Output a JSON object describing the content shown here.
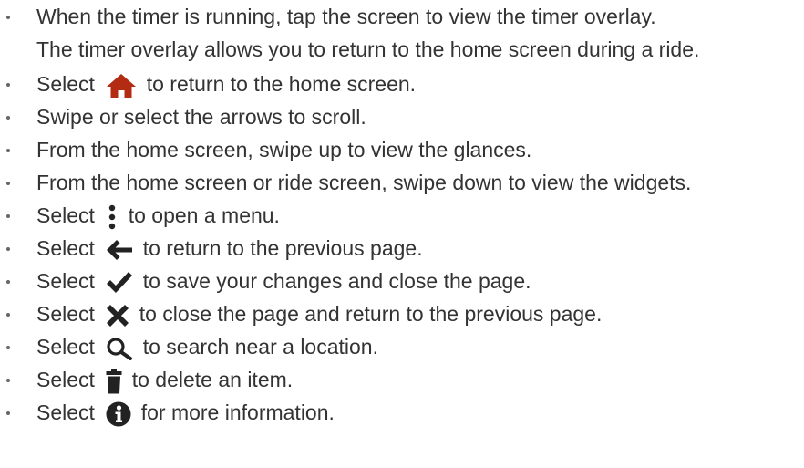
{
  "items": [
    {
      "line1": "When the timer is running, tap the screen to view the timer overlay.",
      "line2": "The timer overlay allows you to return to the home screen during a ride."
    },
    {
      "before": "Select",
      "icon": "home-icon",
      "after": "to return to the home screen."
    },
    {
      "text": "Swipe or select the arrows to scroll."
    },
    {
      "text": "From the home screen, swipe up to view the glances."
    },
    {
      "text": "From the home screen or ride screen, swipe down to view the widgets."
    },
    {
      "before": "Select",
      "icon": "menu-dots-icon",
      "after": "to open a menu."
    },
    {
      "before": "Select",
      "icon": "back-arrow-icon",
      "after": "to return to the previous page."
    },
    {
      "before": "Select",
      "icon": "checkmark-icon",
      "after": "to save your changes and close the page."
    },
    {
      "before": "Select",
      "icon": "close-x-icon",
      "after": "to close the page and return to the previous page."
    },
    {
      "before": "Select",
      "icon": "search-icon",
      "after": "to search near a location."
    },
    {
      "before": "Select",
      "icon": "trash-icon",
      "after": "to delete an item."
    },
    {
      "before": "Select",
      "icon": "info-icon",
      "after": "for more information."
    }
  ]
}
